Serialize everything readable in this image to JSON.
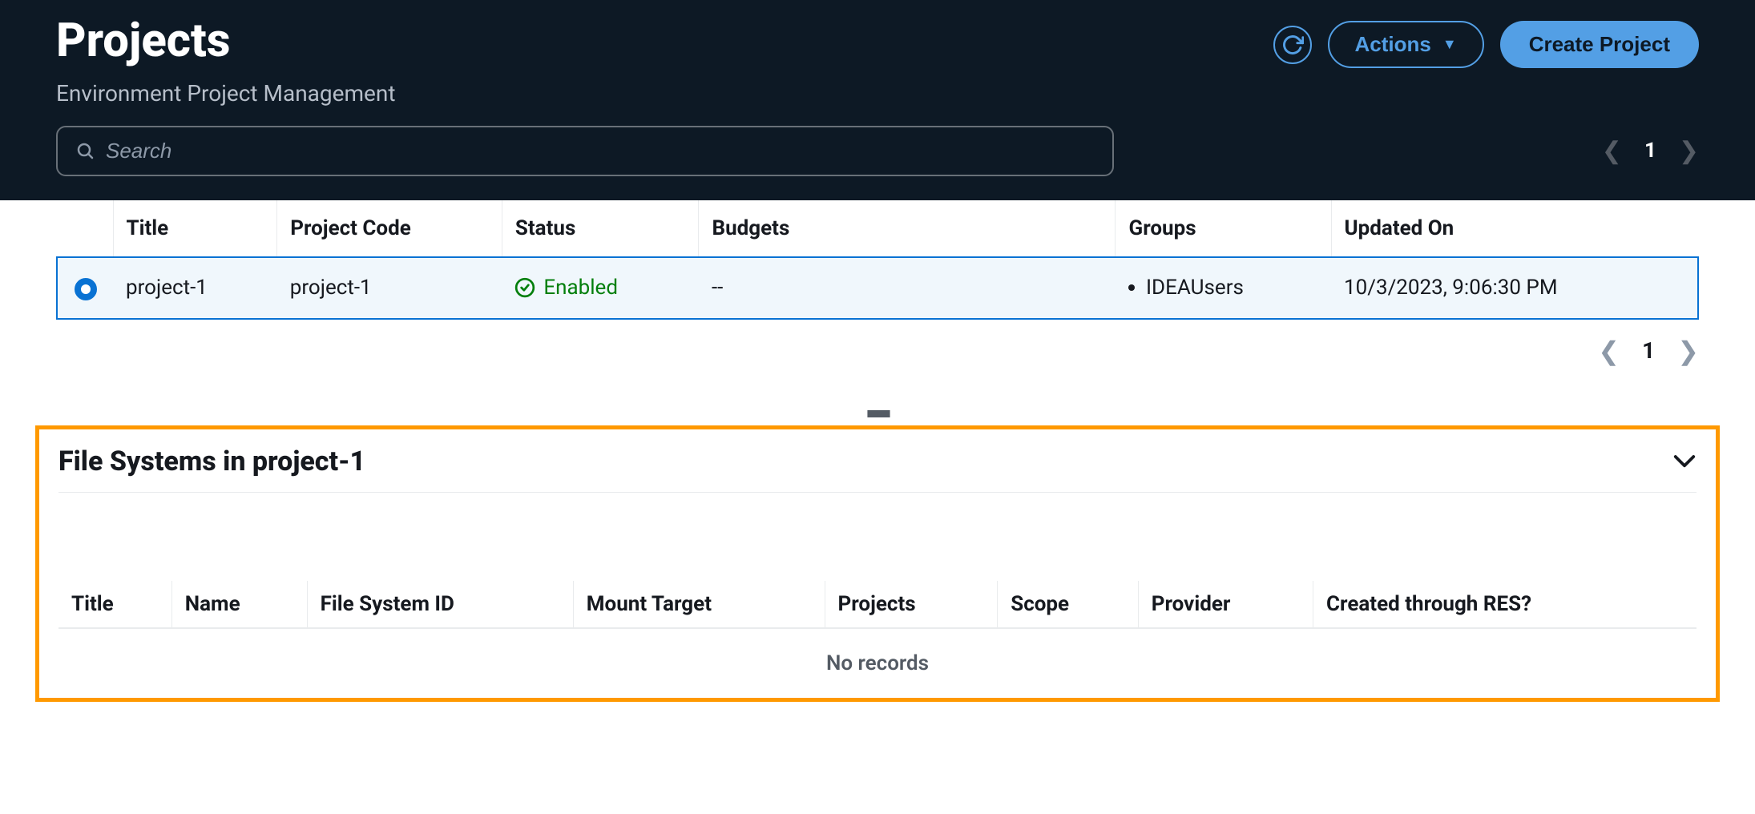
{
  "header": {
    "title": "Projects",
    "subtitle": "Environment Project Management",
    "actions_label": "Actions",
    "create_label": "Create Project"
  },
  "search": {
    "placeholder": "Search"
  },
  "pagination": {
    "top_page": "1",
    "bottom_page": "1"
  },
  "projects_table": {
    "columns": [
      "Title",
      "Project Code",
      "Status",
      "Budgets",
      "Groups",
      "Updated On"
    ],
    "row": {
      "title": "project-1",
      "project_code": "project-1",
      "status": "Enabled",
      "budgets": "--",
      "group": "IDEAUsers",
      "updated_on": "10/3/2023, 9:06:30 PM"
    }
  },
  "filesystems": {
    "title": "File Systems in project-1",
    "columns": [
      "Title",
      "Name",
      "File System ID",
      "Mount Target",
      "Projects",
      "Scope",
      "Provider",
      "Created through RES?"
    ],
    "no_records": "No records"
  }
}
